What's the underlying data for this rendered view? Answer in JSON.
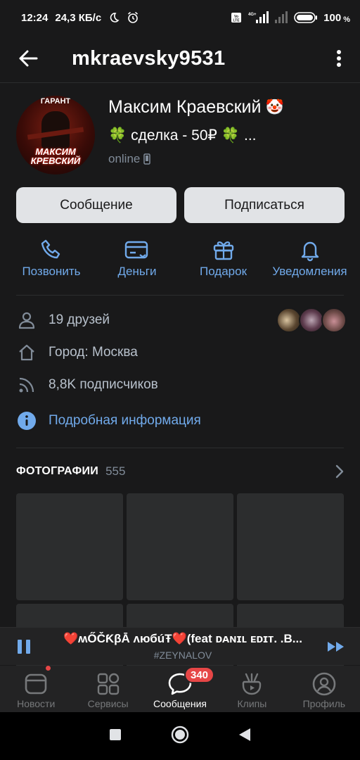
{
  "status_bar": {
    "time": "12:24",
    "network_speed": "24,3 КБ/с",
    "battery": "100",
    "battery_unit": "%",
    "signal_label": "4G+"
  },
  "header": {
    "username": "mkraevsky9531"
  },
  "profile": {
    "name": "Максим Краевский",
    "name_emoji": "🤡",
    "status_text": "сделка - 50₽",
    "status_leaf": "🍀",
    "status_ellipsis": "...",
    "online": "online",
    "avatar_top_text": "ГАРАНТ",
    "avatar_name_text": "МАКСИМ КРЕВСКИЙ"
  },
  "buttons": {
    "message": "Сообщение",
    "subscribe": "Подписаться"
  },
  "quick_actions": [
    {
      "label": "Позвонить",
      "icon": "phone-icon"
    },
    {
      "label": "Деньги",
      "icon": "money-icon"
    },
    {
      "label": "Подарок",
      "icon": "gift-icon"
    },
    {
      "label": "Уведомления",
      "icon": "bell-icon"
    }
  ],
  "info": {
    "friends": "19 друзей",
    "city": "Город: Москва",
    "followers": "8,8K подписчиков",
    "details": "Подробная информация"
  },
  "photos": {
    "title": "ФОТОГРАФИИ",
    "count": "555"
  },
  "player": {
    "title": "❤️ʍŐČƘβĀ ʌюбúŦ❤️(feat ᴅᴀɴɪʟ ᴇᴅɪᴛ. .B...",
    "artist": "#ZEYNALOV"
  },
  "tabbar": {
    "items": [
      {
        "label": "Новости",
        "icon": "news-icon"
      },
      {
        "label": "Сервисы",
        "icon": "services-icon"
      },
      {
        "label": "Сообщения",
        "icon": "messages-icon"
      },
      {
        "label": "Клипы",
        "icon": "clips-icon"
      },
      {
        "label": "Профиль",
        "icon": "profile-icon"
      }
    ],
    "messages_badge": "340"
  },
  "colors": {
    "background": "#19191a",
    "accent": "#71aaeb",
    "badge": "#e64646",
    "button_bg": "#e1e3e6"
  }
}
